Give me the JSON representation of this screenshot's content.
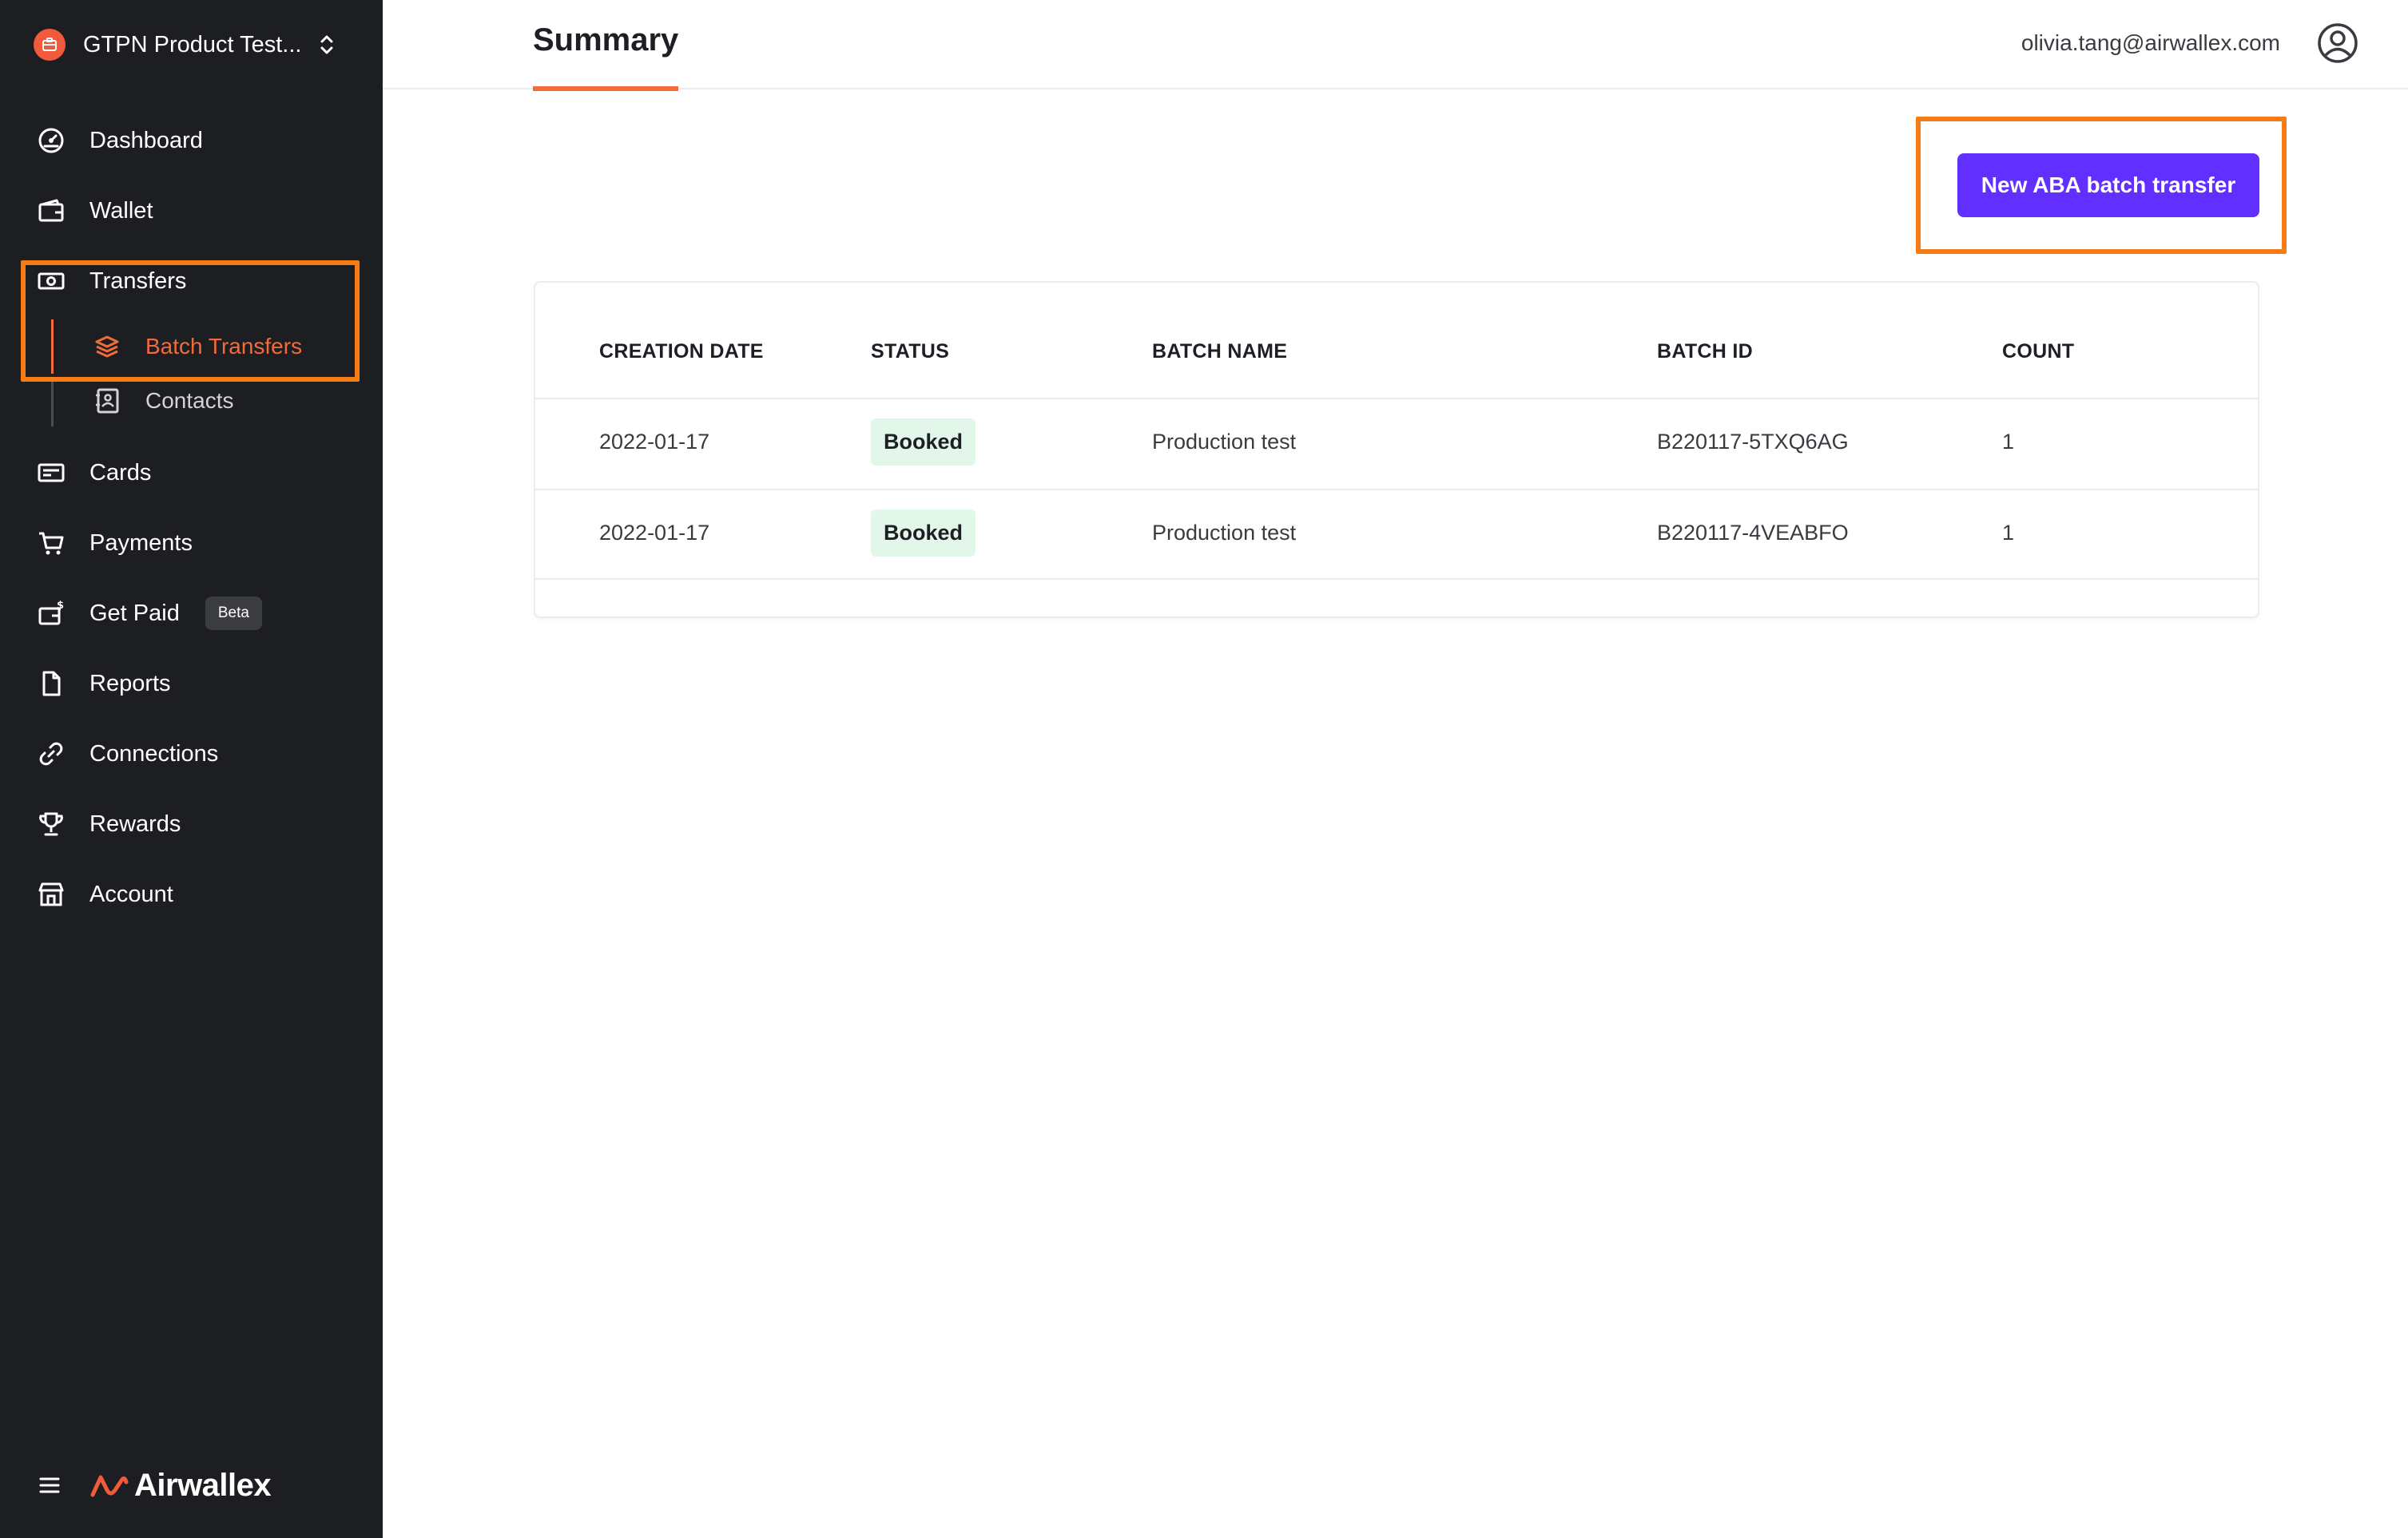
{
  "sidebar": {
    "org_name": "GTPN Product Test...",
    "nav": {
      "dashboard": "Dashboard",
      "wallet": "Wallet",
      "transfers": "Transfers",
      "batch_transfers": "Batch Transfers",
      "contacts": "Contacts",
      "cards": "Cards",
      "payments": "Payments",
      "get_paid": "Get Paid",
      "get_paid_badge": "Beta",
      "reports": "Reports",
      "connections": "Connections",
      "rewards": "Rewards",
      "account": "Account"
    },
    "brand": "Airwallex"
  },
  "header": {
    "tab": "Summary",
    "user_email": "olivia.tang@airwallex.com"
  },
  "main": {
    "new_batch_button": "New ABA batch transfer",
    "table": {
      "columns": [
        "CREATION DATE",
        "STATUS",
        "BATCH NAME",
        "BATCH ID",
        "COUNT"
      ],
      "rows": [
        {
          "date": "2022-01-17",
          "status": "Booked",
          "name": "Production test",
          "id": "B220117-5TXQ6AG",
          "count": "1"
        },
        {
          "date": "2022-01-17",
          "status": "Booked",
          "name": "Production test",
          "id": "B220117-4VEABFO",
          "count": "1"
        }
      ]
    }
  },
  "colors": {
    "sidebar_bg": "#1d1e22",
    "accent_orange": "#f26b3a",
    "highlight_orange": "#f57c16",
    "primary_purple": "#612fff",
    "status_booked_bg": "#e3f6ea"
  }
}
